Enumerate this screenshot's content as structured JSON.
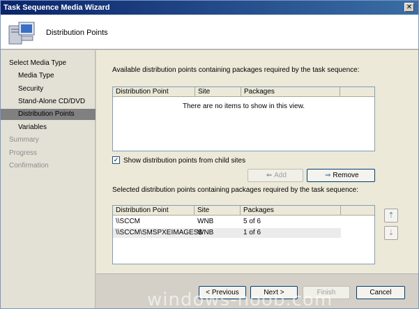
{
  "window": {
    "title": "Task Sequence Media Wizard"
  },
  "header": {
    "title": "Distribution Points",
    "icon": "computer-icon"
  },
  "nav": {
    "items": [
      {
        "label": "Select Media Type",
        "level": 0,
        "state": "normal"
      },
      {
        "label": "Media Type",
        "level": 1,
        "state": "normal"
      },
      {
        "label": "Security",
        "level": 1,
        "state": "normal"
      },
      {
        "label": "Stand-Alone CD/DVD",
        "level": 1,
        "state": "normal"
      },
      {
        "label": "Distribution Points",
        "level": 1,
        "state": "selected"
      },
      {
        "label": "Variables",
        "level": 1,
        "state": "normal"
      },
      {
        "label": "Summary",
        "level": 0,
        "state": "disabled"
      },
      {
        "label": "Progress",
        "level": 0,
        "state": "disabled"
      },
      {
        "label": "Confirmation",
        "level": 0,
        "state": "disabled"
      }
    ]
  },
  "main": {
    "available_label": "Available distribution points containing packages required by the task sequence:",
    "available_list": {
      "columns": [
        "Distribution Point",
        "Site",
        "Packages"
      ],
      "empty_text": "There are no items to show in this view."
    },
    "show_child_sites": {
      "label": "Show distribution points from child sites",
      "checked": true,
      "check_glyph": "✓"
    },
    "add_button": "Add",
    "remove_button": "Remove",
    "selected_label": "Selected distribution points containing packages required by the task sequence:",
    "selected_list": {
      "columns": [
        "Distribution Point",
        "Site",
        "Packages"
      ],
      "rows": [
        {
          "dp": "\\\\SCCM",
          "site": "WNB",
          "packages": "5 of 6"
        },
        {
          "dp": "\\\\SCCM\\SMSPXEIMAGES$",
          "site": "WNB",
          "packages": "1 of 6"
        }
      ]
    }
  },
  "footer": {
    "previous": "< Previous",
    "next": "Next >",
    "finish": "Finish",
    "cancel": "Cancel"
  },
  "watermark": "windows-noob.com"
}
